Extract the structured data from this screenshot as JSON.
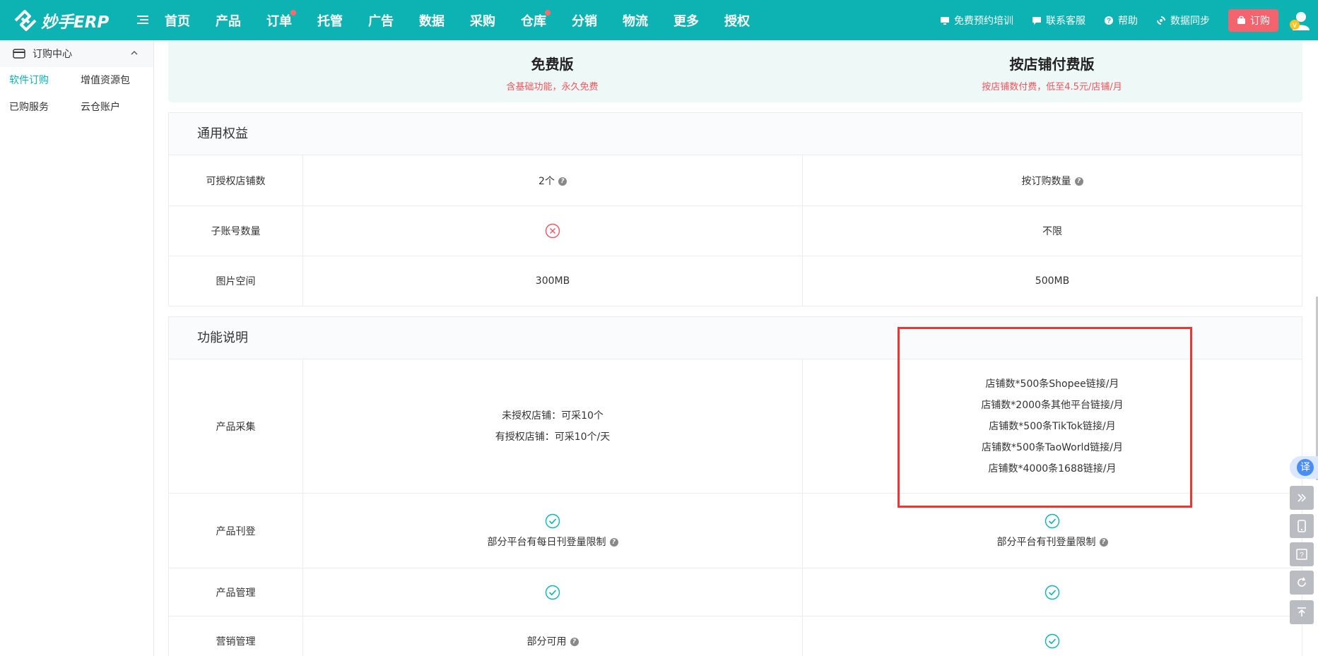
{
  "brand": {
    "name": "妙手ERP"
  },
  "nav": {
    "items": [
      {
        "label": "首页",
        "badge": false
      },
      {
        "label": "产品",
        "badge": false
      },
      {
        "label": "订单",
        "badge": true
      },
      {
        "label": "托管",
        "badge": false
      },
      {
        "label": "广告",
        "badge": false
      },
      {
        "label": "数据",
        "badge": false
      },
      {
        "label": "采购",
        "badge": false
      },
      {
        "label": "仓库",
        "badge": true
      },
      {
        "label": "分销",
        "badge": false
      },
      {
        "label": "物流",
        "badge": false
      },
      {
        "label": "更多",
        "badge": false
      },
      {
        "label": "授权",
        "badge": false
      }
    ]
  },
  "topright": {
    "training": "免费预约培训",
    "support": "联系客服",
    "help": "帮助",
    "sync": "数据同步",
    "order": "订购"
  },
  "sidebar": {
    "header": "订购中心",
    "links": [
      {
        "label": "软件订购",
        "active": true
      },
      {
        "label": "增值资源包",
        "active": false
      },
      {
        "label": "已购服务",
        "active": false
      },
      {
        "label": "云仓账户",
        "active": false
      }
    ]
  },
  "plans": {
    "free": {
      "title": "免费版",
      "subtitle": "含基础功能，永久免费"
    },
    "paid": {
      "title": "按店铺付费版",
      "subtitle": "按店铺数付费，低至4.5元/店铺/月"
    }
  },
  "general": {
    "title": "通用权益",
    "rows": [
      {
        "label": "可授权店铺数",
        "free": "2个",
        "paid": "按订购数量"
      },
      {
        "label": "子账号数量",
        "free": "",
        "paid": "不限"
      },
      {
        "label": "图片空间",
        "free": "300MB",
        "paid": "500MB"
      }
    ]
  },
  "features": {
    "title": "功能说明",
    "collect": {
      "label": "产品采集",
      "free": [
        "未授权店铺：可采10个",
        "有授权店铺：可采10个/天"
      ],
      "paid": [
        "店铺数*500条Shopee链接/月",
        "店铺数*2000条其他平台链接/月",
        "店铺数*500条TikTok链接/月",
        "店铺数*500条TaoWorld链接/月",
        "店铺数*4000条1688链接/月"
      ]
    },
    "publish": {
      "label": "产品刊登",
      "free": "部分平台有每日刊登量限制",
      "paid": "部分平台有刊登量限制"
    },
    "manage": {
      "label": "产品管理"
    },
    "marketing": {
      "label": "营销管理",
      "free": "部分可用"
    }
  },
  "floating": {
    "translate": "译"
  },
  "colors": {
    "brand": "#0db3b3",
    "accent_red": "#f0555f",
    "highlight": "#e53935"
  }
}
